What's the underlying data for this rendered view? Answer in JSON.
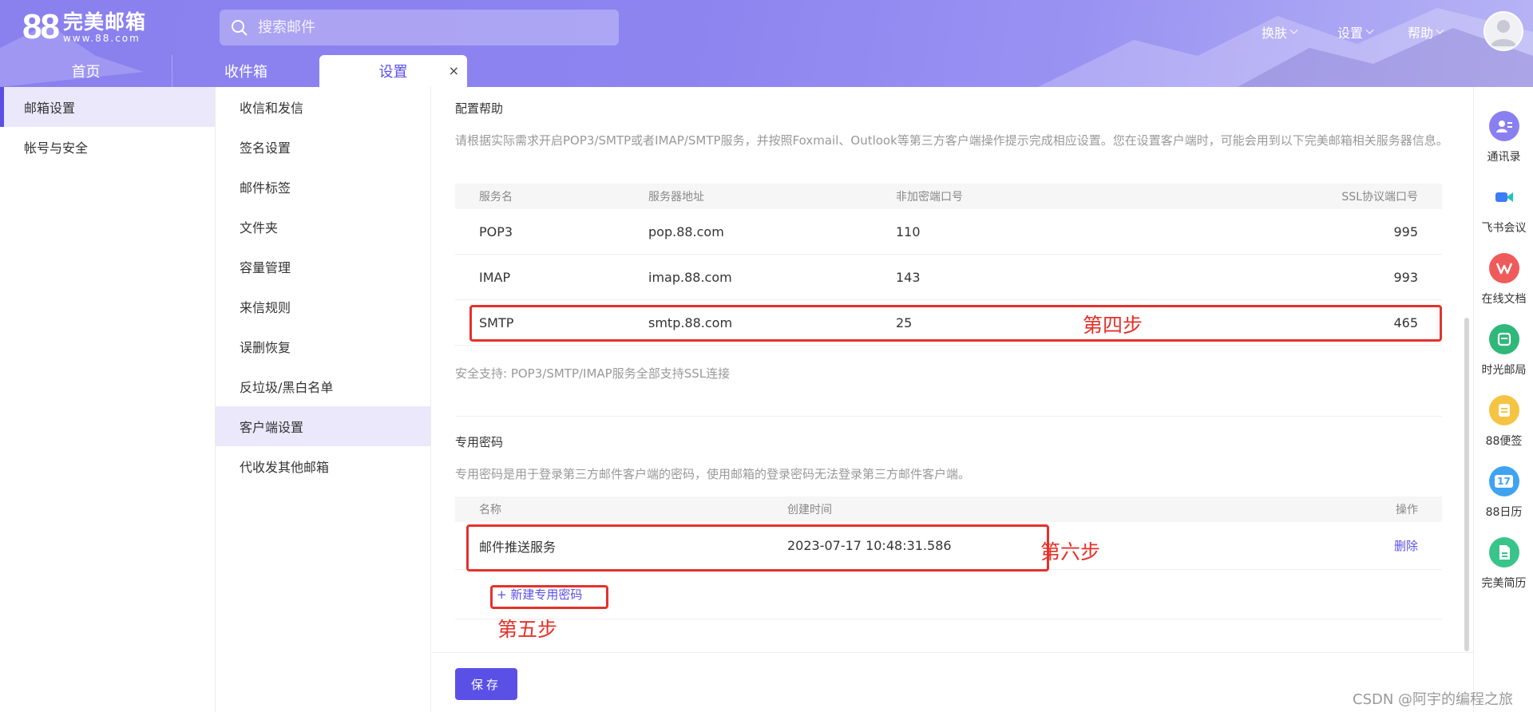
{
  "header": {
    "logo_number": "88",
    "logo_name": "完美邮箱",
    "logo_url": "www.88.com",
    "search_placeholder": "搜索邮件",
    "nav": [
      {
        "label": "换肤"
      },
      {
        "label": "设置"
      },
      {
        "label": "帮助"
      }
    ]
  },
  "tabs": [
    {
      "label": "首页"
    },
    {
      "label": "收件箱"
    },
    {
      "label": "设置",
      "close": "×"
    }
  ],
  "sidebar_primary": [
    {
      "label": "邮箱设置"
    },
    {
      "label": "帐号与安全"
    }
  ],
  "sidebar_secondary": [
    {
      "label": "收信和发信"
    },
    {
      "label": "签名设置"
    },
    {
      "label": "邮件标签"
    },
    {
      "label": "文件夹"
    },
    {
      "label": "容量管理"
    },
    {
      "label": "来信规则"
    },
    {
      "label": "误删恢复"
    },
    {
      "label": "反垃圾/黑白名单"
    },
    {
      "label": "客户端设置"
    },
    {
      "label": "代收发其他邮箱"
    }
  ],
  "config_help": {
    "title": "配置帮助",
    "description": "请根据实际需求开启POP3/SMTP或者IMAP/SMTP服务，并按照Foxmail、Outlook等第三方客户端操作提示完成相应设置。您在设置客户端时，可能会用到以下完美邮箱相关服务器信息。",
    "columns": [
      "服务名",
      "服务器地址",
      "非加密端口号",
      "SSL协议端口号"
    ],
    "rows": [
      [
        "POP3",
        "pop.88.com",
        "110",
        "995"
      ],
      [
        "IMAP",
        "imap.88.com",
        "143",
        "993"
      ],
      [
        "SMTP",
        "smtp.88.com",
        "25",
        "465"
      ]
    ],
    "security_note": "安全支持: POP3/SMTP/IMAP服务全部支持SSL连接"
  },
  "app_password": {
    "title": "专用密码",
    "description": "专用密码是用于登录第三方邮件客户端的密码，使用邮箱的登录密码无法登录第三方邮件客户端。",
    "columns": [
      "名称",
      "创建时间",
      "操作"
    ],
    "rows": [
      {
        "name": "邮件推送服务",
        "created": "2023-07-17 10:48:31.586",
        "action": "删除"
      }
    ],
    "new_label": "+ 新建专用密码"
  },
  "annotations": {
    "step4": "第四步",
    "step5": "第五步",
    "step6": "第六步"
  },
  "save_label": "保存",
  "right_apps": [
    {
      "label": "通讯录",
      "icon": "contacts-icon",
      "color": "#8a7ff0"
    },
    {
      "label": "飞书会议",
      "icon": "video-icon",
      "color": "#ffffff"
    },
    {
      "label": "在线文档",
      "icon": "wps-icon",
      "color": "#ef5b5b"
    },
    {
      "label": "时光邮局",
      "icon": "mailbox-icon",
      "color": "#2fb87a"
    },
    {
      "label": "88便签",
      "icon": "note-icon",
      "color": "#f6c443"
    },
    {
      "label": "88日历",
      "icon": "calendar-icon",
      "color": "#3fa3f2"
    },
    {
      "label": "完美简历",
      "icon": "resume-icon",
      "color": "#39c48a"
    }
  ],
  "calendar_day": "17",
  "watermark": "CSDN @阿宇的编程之旅"
}
